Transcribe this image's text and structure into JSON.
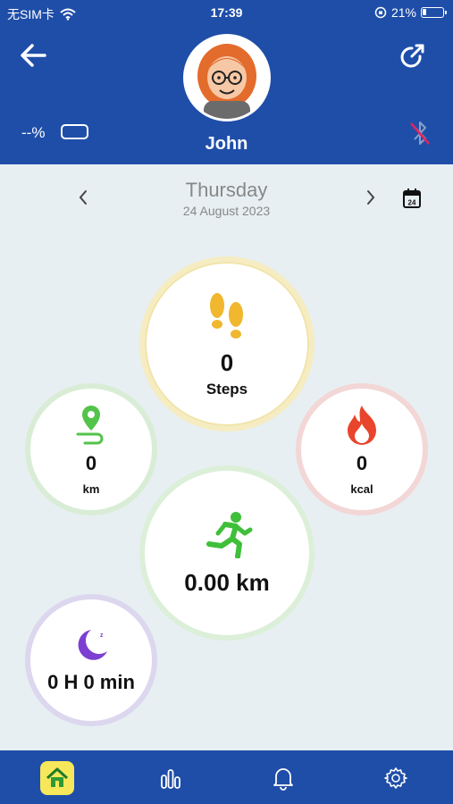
{
  "status_bar": {
    "carrier": "无SIM卡",
    "time": "17:39",
    "battery": "21%",
    "battery_level": 0.21
  },
  "header": {
    "user_name": "John",
    "device_battery": "--%",
    "bluetooth_status": "disconnected",
    "colors": {
      "primary": "#1f4ea9"
    }
  },
  "date_nav": {
    "day": "Thursday",
    "date": "24 August 2023",
    "calendar_day": "24"
  },
  "metrics": {
    "steps": {
      "value": "0",
      "unit": "Steps",
      "color": "#f0b72f"
    },
    "distance": {
      "value": "0",
      "unit": "km",
      "color": "#53c34a"
    },
    "calories": {
      "value": "0",
      "unit": "kcal",
      "color": "#e8452c"
    },
    "activity": {
      "value": "0.00 km",
      "color": "#3fbf3a"
    },
    "sleep": {
      "value": "0 H 0 min",
      "color": "#7d3fd1"
    }
  },
  "bottom_nav": {
    "items": [
      "home-icon",
      "stats-icon",
      "bell-icon",
      "gear-icon"
    ],
    "active": "home"
  }
}
